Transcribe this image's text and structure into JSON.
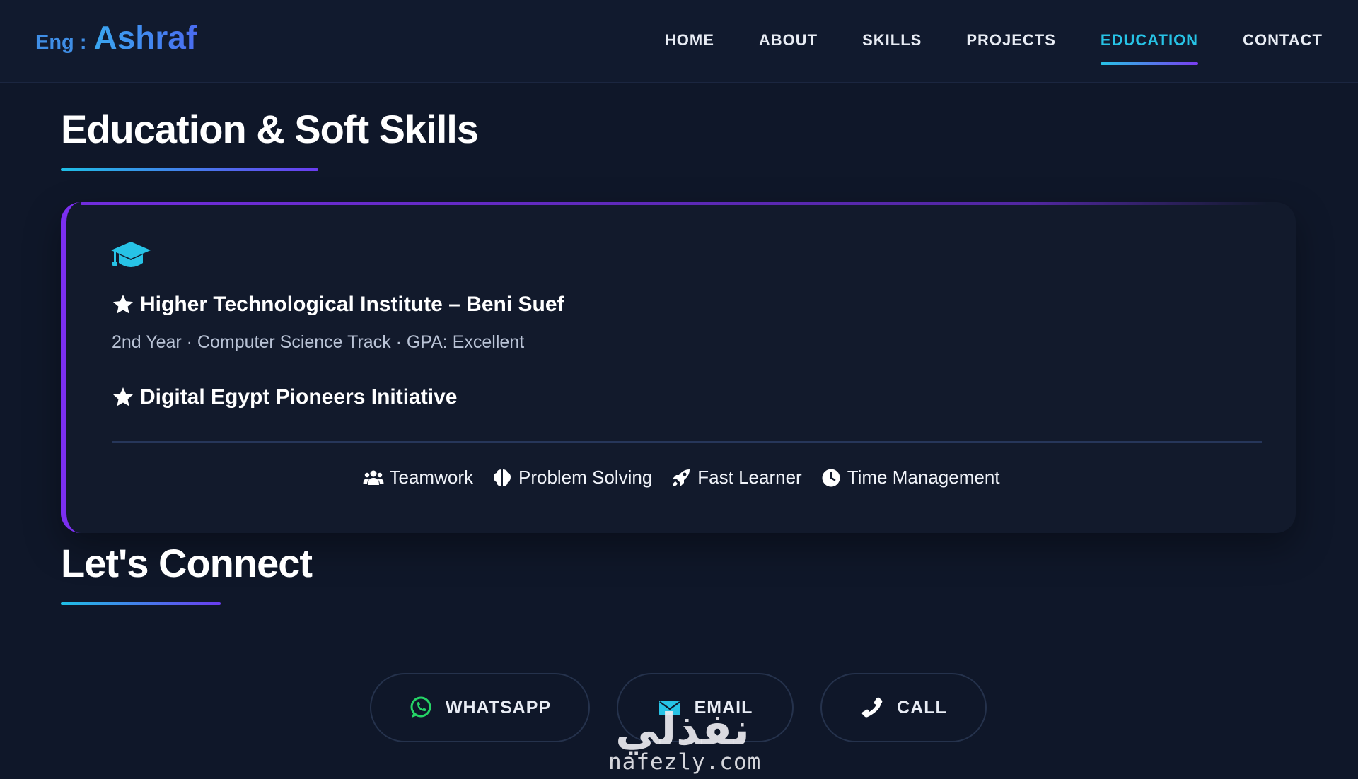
{
  "brand": {
    "prefix": "Eng :",
    "name": "Ashraf"
  },
  "nav": {
    "items": [
      {
        "label": "HOME",
        "active": false
      },
      {
        "label": "ABOUT",
        "active": false
      },
      {
        "label": "SKILLS",
        "active": false
      },
      {
        "label": "PROJECTS",
        "active": false
      },
      {
        "label": "EDUCATION",
        "active": true
      },
      {
        "label": "CONTACT",
        "active": false
      }
    ]
  },
  "education": {
    "title": "Education & Soft Skills",
    "icon": "graduation-cap-icon",
    "entries": [
      {
        "title": "Higher Technological Institute – Beni Suef",
        "subtitle": "2nd Year · Computer Science Track · GPA: Excellent"
      },
      {
        "title": "Digital Egypt Pioneers Initiative"
      }
    ],
    "soft_skills": [
      {
        "icon": "users-icon",
        "label": "Teamwork"
      },
      {
        "icon": "brain-icon",
        "label": "Problem Solving"
      },
      {
        "icon": "rocket-icon",
        "label": "Fast Learner"
      },
      {
        "icon": "clock-icon",
        "label": "Time Management"
      }
    ]
  },
  "connect": {
    "title": "Let's Connect",
    "buttons": [
      {
        "icon": "whatsapp-icon",
        "label": "WHATSAPP"
      },
      {
        "icon": "email-icon",
        "label": "EMAIL"
      },
      {
        "icon": "phone-icon",
        "label": "CALL"
      }
    ]
  },
  "watermark": {
    "arabic": "نفذلي",
    "site": "nafezly.com"
  },
  "colors": {
    "accent_cyan": "#27c3e6",
    "accent_purple": "#7b2ff0",
    "background": "#0f1729",
    "whatsapp_green": "#25d366"
  }
}
